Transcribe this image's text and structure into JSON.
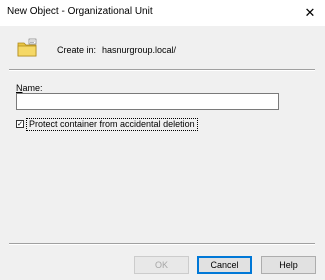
{
  "window": {
    "title": "New Object - Organizational Unit",
    "close_glyph": "✕"
  },
  "header": {
    "icon": "folder-ou-icon",
    "create_in_label": "Create in:",
    "create_in_path": "hasnurgroup.local/"
  },
  "form": {
    "name_label_mnemonic": "N",
    "name_label_rest": "ame:",
    "name_value": "",
    "protect_checkbox": {
      "checked": true,
      "check_glyph": "✓",
      "label": "Protect container from accidental deletion"
    }
  },
  "buttons": {
    "ok": "OK",
    "cancel": "Cancel",
    "help": "Help"
  },
  "colors": {
    "folder": "#e8c545",
    "default_button_border": "#0078d7"
  }
}
